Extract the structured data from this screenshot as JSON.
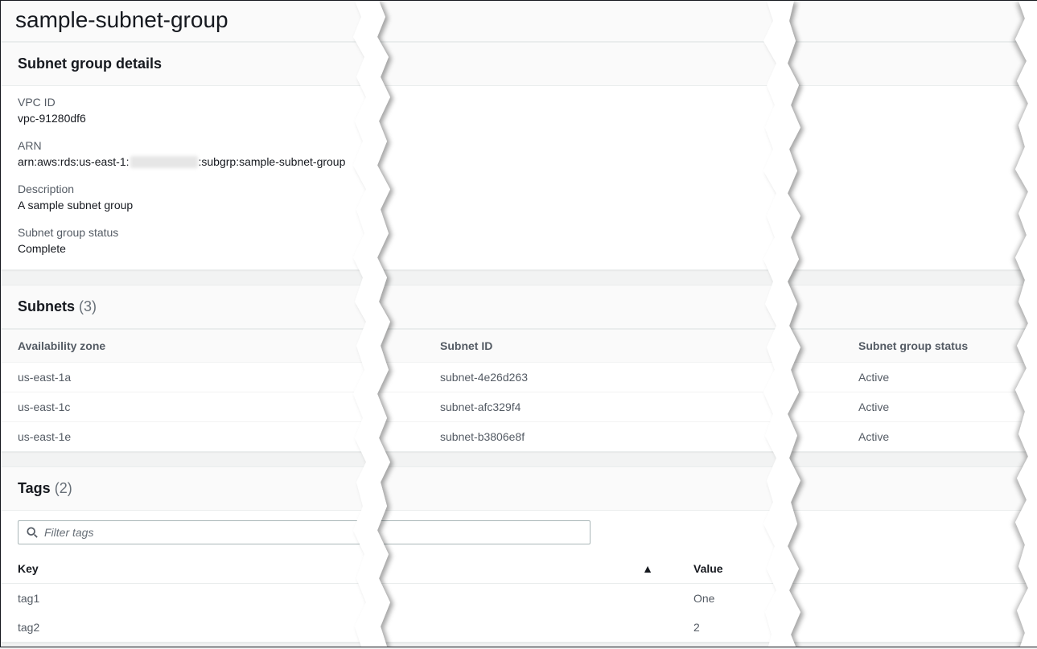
{
  "page": {
    "title": "sample-subnet-group"
  },
  "details": {
    "heading": "Subnet group details",
    "vpc_id_label": "VPC ID",
    "vpc_id_value": "vpc-91280df6",
    "arn_label": "ARN",
    "arn_prefix": "arn:aws:rds:us-east-1:",
    "arn_suffix": ":subgrp:sample-subnet-group",
    "description_label": "Description",
    "description_value": "A sample subnet group",
    "status_label": "Subnet group status",
    "status_value": "Complete"
  },
  "subnets": {
    "heading": "Subnets",
    "count": "(3)",
    "columns": {
      "az": "Availability zone",
      "subnet_id": "Subnet ID",
      "status": "Subnet group status"
    },
    "rows": [
      {
        "az": "us-east-1a",
        "subnet_id": "subnet-4e26d263",
        "status": "Active"
      },
      {
        "az": "us-east-1c",
        "subnet_id": "subnet-afc329f4",
        "status": "Active"
      },
      {
        "az": "us-east-1e",
        "subnet_id": "subnet-b3806e8f",
        "status": "Active"
      }
    ]
  },
  "tags": {
    "heading": "Tags",
    "count": "(2)",
    "filter_placeholder": "Filter tags",
    "columns": {
      "key": "Key",
      "value": "Value"
    },
    "rows": [
      {
        "key": "tag1",
        "value": "One"
      },
      {
        "key": "tag2",
        "value": "2"
      }
    ]
  }
}
